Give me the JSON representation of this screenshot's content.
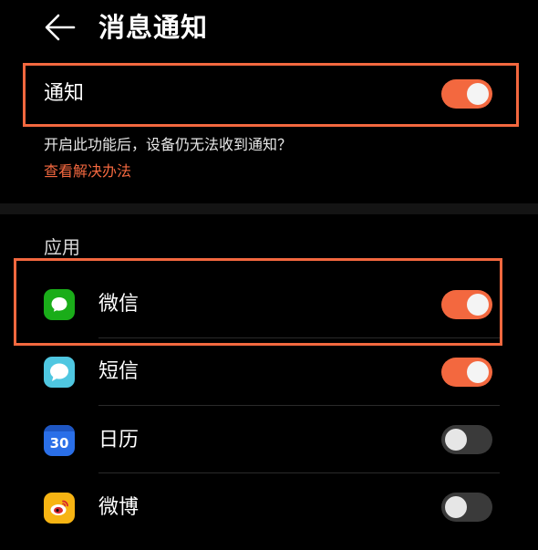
{
  "header": {
    "title": "消息通知",
    "back_icon": "arrow-left-icon"
  },
  "notification": {
    "label": "通知",
    "enabled": true,
    "description": "开启此功能后，设备仍无法收到通知？",
    "link_text": "查看解决办法"
  },
  "apps": {
    "section_title": "应用",
    "items": [
      {
        "name": "微信",
        "icon": "wechat-icon",
        "enabled": true
      },
      {
        "name": "短信",
        "icon": "sms-icon",
        "enabled": true
      },
      {
        "name": "日历",
        "icon": "calendar-icon",
        "icon_text": "30",
        "enabled": false
      },
      {
        "name": "微博",
        "icon": "weibo-icon",
        "enabled": false
      }
    ]
  },
  "colors": {
    "accent": "#f3683f",
    "toggle_off": "#3a3a3a",
    "wechat": "#1aad19",
    "sms": "#4fc7e1",
    "calendar": "#2a6fe8",
    "weibo": "#f7b413"
  }
}
